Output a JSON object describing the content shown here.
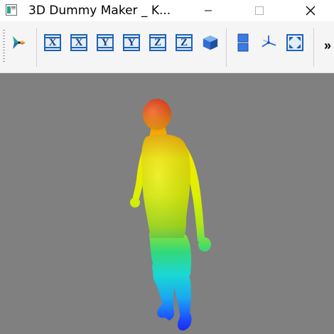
{
  "window": {
    "title": "3D Dummy Maker _ K...",
    "controls": [
      "minimize",
      "maximize",
      "close"
    ]
  },
  "toolbar": {
    "buttons": [
      {
        "name": "rotate-tool-icon"
      },
      {
        "name": "view-x-front-button",
        "label": "X"
      },
      {
        "name": "view-x-back-button",
        "label": "X"
      },
      {
        "name": "view-y-front-button",
        "label": "Y"
      },
      {
        "name": "view-y-back-button",
        "label": "Y"
      },
      {
        "name": "view-z-front-button",
        "label": "Z"
      },
      {
        "name": "view-z-back-button",
        "label": "Z"
      },
      {
        "name": "view-3d-cube-button"
      },
      {
        "name": "split-view-button"
      },
      {
        "name": "axes-icon-button"
      },
      {
        "name": "fit-to-window-button"
      }
    ],
    "overflow_label": "»"
  },
  "viewport": {
    "background": "#808080",
    "model": "human dummy figure with height color map (red head to blue feet)"
  },
  "colors": {
    "axis_button_border": "#1e63b8",
    "cube": "#2f6fd1",
    "gradient": [
      "#e53a17",
      "#f7e000",
      "#b8e800",
      "#26d88a",
      "#1ad6e6",
      "#1e3cff"
    ]
  }
}
